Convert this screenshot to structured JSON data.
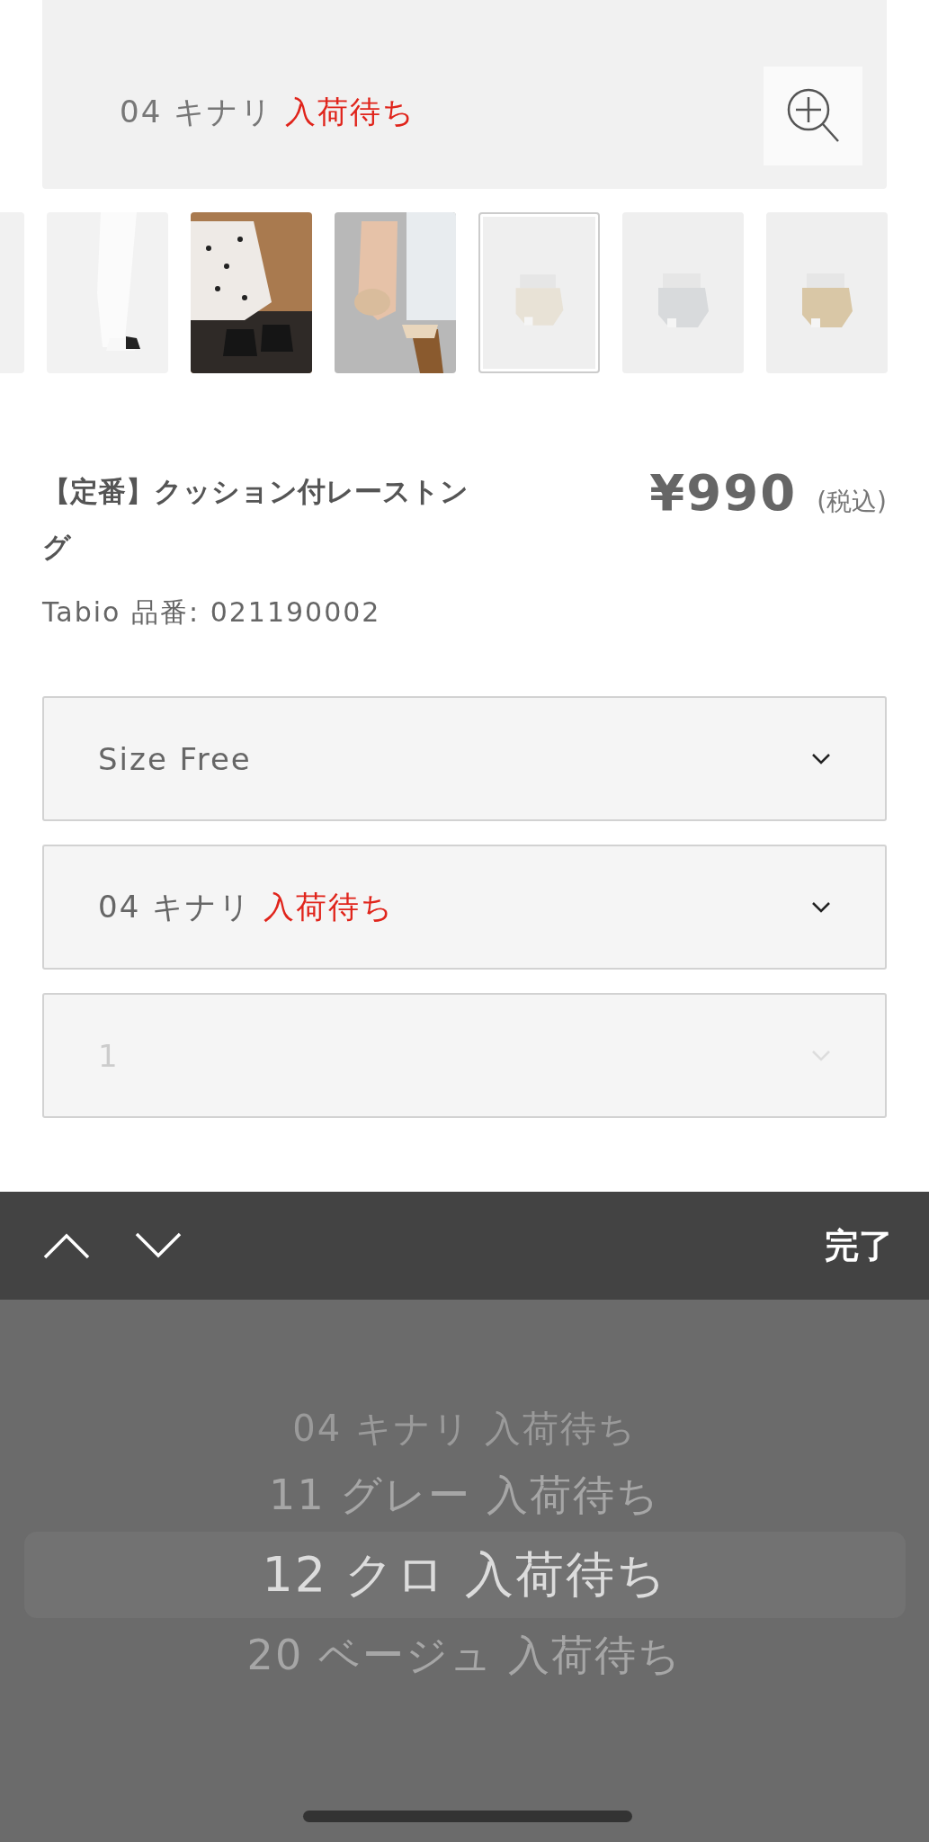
{
  "product_image": {
    "caption_code": "04 キナリ",
    "caption_status": "入荷待ち"
  },
  "thumbnails": [
    {
      "kind": "picture",
      "selected": false
    },
    {
      "kind": "picture",
      "selected": false
    },
    {
      "kind": "picture",
      "selected": false
    },
    {
      "kind": "picture",
      "selected": false
    },
    {
      "kind": "picture",
      "selected": true
    },
    {
      "kind": "picture",
      "selected": false
    },
    {
      "kind": "picture",
      "selected": false
    }
  ],
  "product": {
    "title": "【定番】クッション付レーストング",
    "price": "¥990",
    "tax_note": "(税込)",
    "code_line": "Tabio 品番: 021190002"
  },
  "selects": [
    {
      "value": "Size Free",
      "disabled": false
    },
    {
      "value": "04 キナリ",
      "status": "入荷待ち",
      "disabled": false
    },
    {
      "value": "1",
      "disabled": true
    }
  ],
  "toolbar": {
    "done_label": "完了"
  },
  "picker": {
    "options": [
      {
        "label": "04 キナリ 入荷待ち",
        "selected": false
      },
      {
        "label": "11 グレー 入荷待ち",
        "selected": false
      },
      {
        "label": "12 クロ 入荷待ち",
        "selected": true
      },
      {
        "label": "20 ベージュ 入荷待ち",
        "selected": false
      }
    ]
  }
}
